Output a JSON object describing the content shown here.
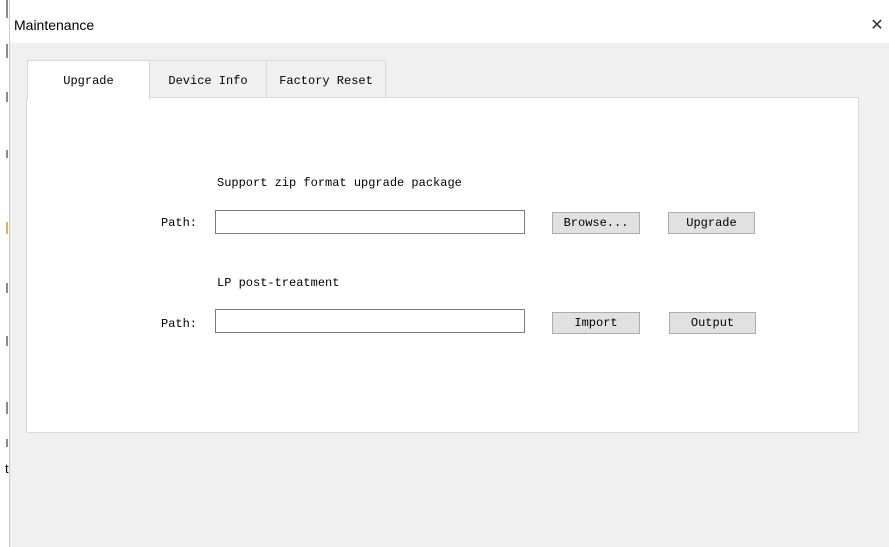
{
  "window": {
    "title": "Maintenance",
    "close_glyph": "✕"
  },
  "tabs": [
    {
      "label": "Upgrade",
      "active": true
    },
    {
      "label": "Device Info",
      "active": false
    },
    {
      "label": "Factory Reset",
      "active": false
    }
  ],
  "upgrade": {
    "description": "Support zip format upgrade package",
    "path_label": "Path:",
    "path_value": "",
    "browse_label": "Browse...",
    "upgrade_label": "Upgrade"
  },
  "lp": {
    "description": "LP post-treatment",
    "path_label": "Path:",
    "path_value": "",
    "import_label": "Import",
    "output_label": "Output"
  },
  "background_fragment": {
    "char": "t"
  },
  "icons": {
    "close": "close-icon"
  },
  "colors": {
    "window_bg": "#f0f0f0",
    "panel_bg": "#ffffff",
    "button_bg": "#e1e1e1",
    "border": "#d9d9d9"
  }
}
